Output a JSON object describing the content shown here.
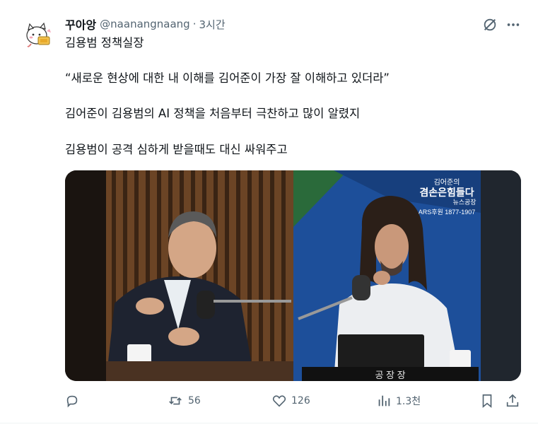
{
  "author": {
    "display_name": "꾸아앙",
    "handle": "@naanangnaang",
    "separator": "·",
    "time": "3시간"
  },
  "tweet_lines": [
    "김용범 정책실장",
    "“새로운 현상에 대한 내 이해를 김어준이 가장 잘 이해하고 있더라”",
    "김어준이 김용범의 AI 정책을 처음부터 극찬하고 많이 알렸지",
    "김용범이 공격 심하게 받을때도 대신 싸워주고"
  ],
  "media": {
    "logo_line1": "김어준의",
    "logo_line2": "겸손은힘들다",
    "logo_line3": "뉴스공장",
    "logo_phone": "ARS후원 1877-1907",
    "banner_text": "공 장 장"
  },
  "actions": {
    "reply": "",
    "retweet": "56",
    "like": "126",
    "views": "1.3천"
  },
  "icons": {
    "reply": "reply-icon",
    "retweet": "retweet-icon",
    "like": "heart-icon",
    "views": "views-icon",
    "bookmark": "bookmark-icon",
    "share": "share-icon",
    "grok": "grok-icon",
    "more": "more-icon"
  },
  "colors": {
    "text": "#0f1419",
    "secondary": "#536471",
    "studio_blue": "#1d4f9a"
  }
}
